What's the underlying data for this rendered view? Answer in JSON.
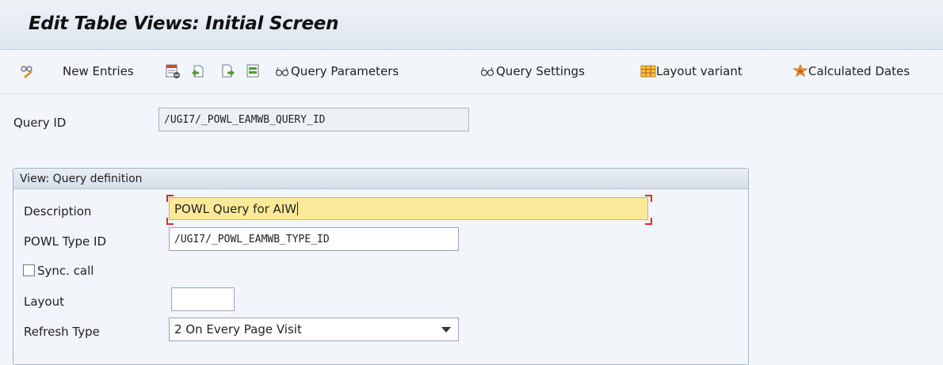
{
  "title": "Edit Table Views: Initial Screen",
  "toolbar": {
    "new_entries": "New Entries",
    "query_parameters": "Query Parameters",
    "query_settings": "Query Settings",
    "layout_variant": "Layout variant",
    "calculated_dates": "Calculated Dates"
  },
  "query_id": {
    "label": "Query ID",
    "value": "/UGI7/_POWL_EAMWB_QUERY_ID"
  },
  "group": {
    "title": "View: Query definition",
    "description_label": "Description",
    "description_value": "POWL Query for AIW",
    "powl_type_label": "POWL Type ID",
    "powl_type_value": "/UGI7/_POWL_EAMWB_TYPE_ID",
    "sync_call_label": "Sync. call",
    "sync_call_checked": false,
    "layout_label": "Layout",
    "layout_value": "",
    "refresh_type_label": "Refresh Type",
    "refresh_type_value": "2 On Every Page Visit"
  }
}
